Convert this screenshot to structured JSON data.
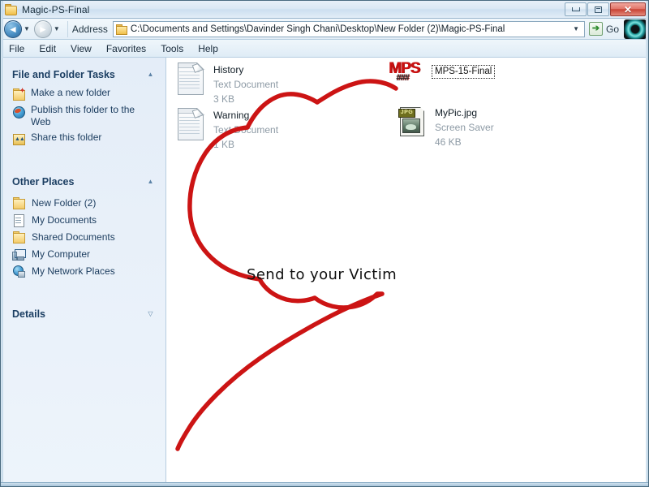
{
  "window": {
    "title": "Magic-PS-Final",
    "icon": "folder-icon",
    "controls": {
      "minimize": "Minimize",
      "maximize": "Maximize",
      "close": "Close",
      "close_glyph": "✕"
    }
  },
  "toolbar": {
    "back_label": "Back",
    "back_glyph": "◄",
    "forward_label": "Forward",
    "forward_glyph": "►",
    "dropdown_glyph": "▼",
    "address_label": "Address",
    "address_value": "C:\\Documents and Settings\\Davinder Singh Chani\\Desktop\\New Folder (2)\\Magic-PS-Final",
    "address_placeholder": "Address",
    "go_label": "Go",
    "go_glyph": "➔",
    "brand_icon": "teal-ring-logo"
  },
  "menubar": {
    "items": [
      {
        "label": "File"
      },
      {
        "label": "Edit"
      },
      {
        "label": "View"
      },
      {
        "label": "Favorites"
      },
      {
        "label": "Tools"
      },
      {
        "label": "Help"
      }
    ]
  },
  "sidebar": {
    "panels": [
      {
        "title": "File and Folder Tasks",
        "collapse_glyph": "▲",
        "tasks": [
          {
            "label": "Make a new folder",
            "icon": "new-folder-icon"
          },
          {
            "label": "Publish this folder to the Web",
            "icon": "globe-icon"
          },
          {
            "label": "Share this folder",
            "icon": "share-folder-icon"
          }
        ]
      },
      {
        "title": "Other Places",
        "collapse_glyph": "▲",
        "places": [
          {
            "label": "New Folder (2)",
            "icon": "folder-icon"
          },
          {
            "label": "My Documents",
            "icon": "documents-icon"
          },
          {
            "label": "Shared Documents",
            "icon": "folder-icon"
          },
          {
            "label": "My Computer",
            "icon": "computer-icon"
          },
          {
            "label": "My Network Places",
            "icon": "network-icon"
          }
        ]
      },
      {
        "title": "Details",
        "collapse_glyph": "▽",
        "tasks": []
      }
    ]
  },
  "files": [
    {
      "name": "History",
      "type": "Text Document",
      "size": "3 KB",
      "icon": "text-document-icon"
    },
    {
      "name": "Warning",
      "type": "Text Document",
      "size": "1 KB",
      "icon": "text-document-icon"
    },
    {
      "name": "MyPic.jpg",
      "type": "Screen Saver",
      "size": "46 KB",
      "icon": "jpg-file-icon"
    }
  ],
  "overlay": {
    "logo_text": "MPS",
    "logo_sub": "###",
    "tag_text": "MPS-15-Final",
    "annotation_text": "Send to your Victim",
    "annotation_color": "#cc1414"
  }
}
